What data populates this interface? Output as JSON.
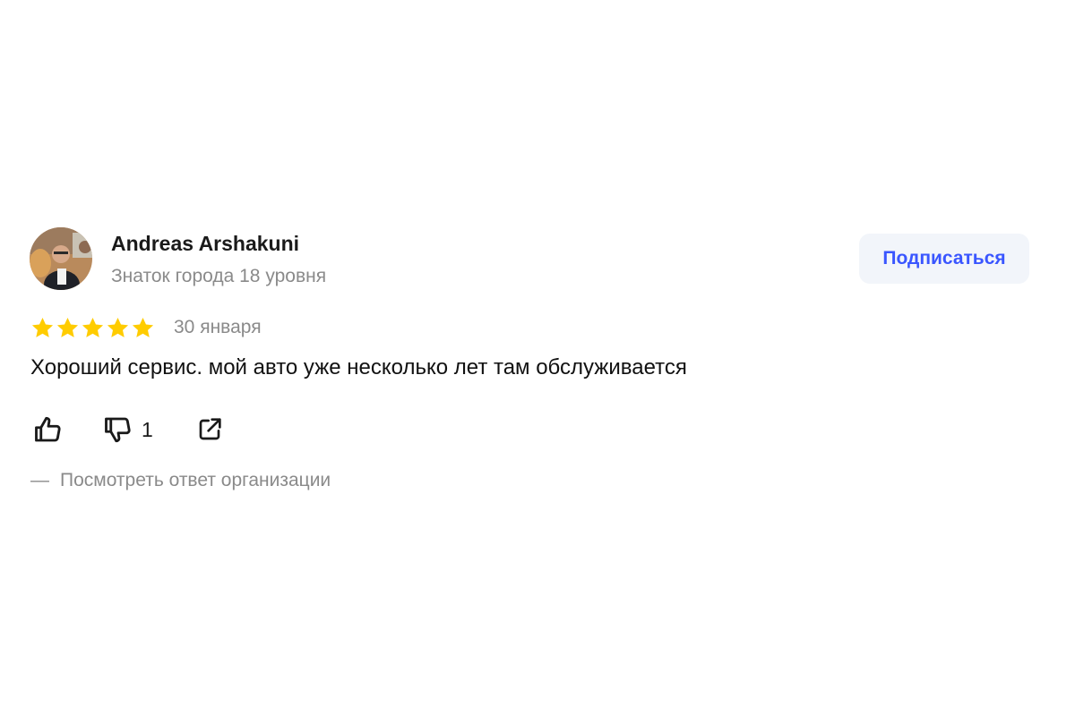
{
  "author": {
    "name": "Andreas Arshakuni",
    "level": "Знаток города 18 уровня"
  },
  "subscribe": {
    "label": "Подписаться"
  },
  "review": {
    "rating": 5,
    "rating_max": 5,
    "date": "30 января",
    "text": "Хороший сервис. мой авто уже несколько лет там обслуживается"
  },
  "actions": {
    "like_icon": "thumbs-up-icon",
    "dislike_icon": "thumbs-down-icon",
    "dislike_count": "1",
    "share_icon": "share-icon"
  },
  "org_reply": {
    "dash": "—",
    "label": "Посмотреть ответ организации"
  },
  "colors": {
    "accent": "#3a56ff",
    "star": "#ffcc00",
    "muted_text": "#8a8a8a",
    "button_bg": "#f2f5fa"
  }
}
